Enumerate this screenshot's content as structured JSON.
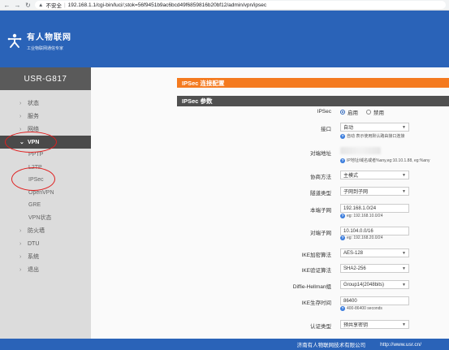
{
  "browser": {
    "security": "不安全",
    "url": "192.168.1.1/cgi-bin/luci/;stok=56f9451b9ac6bcd49f6859816b20bf12/admin/vpn/ipsec"
  },
  "header": {
    "brand": "有人物联网",
    "tagline": "工业物联网通信专家"
  },
  "sidebar": {
    "model": "USR-G817",
    "items": [
      {
        "label": "状态"
      },
      {
        "label": "服务"
      },
      {
        "label": "网络"
      },
      {
        "label": "VPN"
      },
      {
        "label": "防火墙"
      },
      {
        "label": "DTU"
      },
      {
        "label": "系统"
      },
      {
        "label": "退出"
      }
    ],
    "vpn_sub": [
      "PPTP",
      "L2TP",
      "IPSec",
      "OpenVPN",
      "GRE",
      "VPN状态"
    ]
  },
  "main": {
    "page_title": "IPSec 连接配置",
    "section_title": "IPSec 参数",
    "ipsec": {
      "label": "IPSec",
      "on": "启用",
      "off": "禁用"
    },
    "iface": {
      "label": "接口",
      "value": "自动",
      "hint": "自动  表示使用默认路由接口连接"
    },
    "peer": {
      "label": "对端地址",
      "hint": "IP地址/域名或者%any,eg:10.10.1.88, eg:%any"
    },
    "proto": {
      "label": "协商方法",
      "value": "主模式"
    },
    "tunnel": {
      "label": "隧道类型",
      "value": "子网到子网"
    },
    "local_subnet": {
      "label": "本端子网",
      "value": "192.168.1.0/24",
      "hint": "eg: 192.168.10.0/24"
    },
    "remote_subnet": {
      "label": "对端子网",
      "value": "10.104.0.0/16",
      "hint": "eg: 192.168.20.0/24"
    },
    "ike_enc": {
      "label": "IKE加密算法",
      "value": "AES-128"
    },
    "ike_auth": {
      "label": "IKE验证算法",
      "value": "SHA2-256"
    },
    "dh": {
      "label": "Diffie-Hellman组",
      "value": "Group14(2048bits)"
    },
    "ike_life": {
      "label": "IKE生存时间",
      "value": "86400",
      "hint": "400-86400 seconds"
    },
    "auth_type": {
      "label": "认证类型",
      "value": "预共享密钥"
    }
  },
  "footer": {
    "company": "济南有人物联网技术有限公司",
    "url": "http://www.usr.cn/"
  },
  "colors": {
    "header": "#2a63b8",
    "accent": "#f47a1f",
    "annotation": "#e02020"
  }
}
